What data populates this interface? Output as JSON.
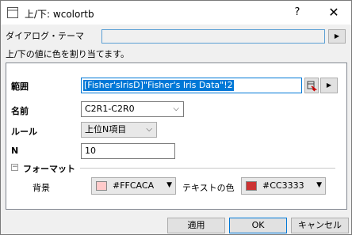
{
  "window": {
    "title": "上/下: wcolortb",
    "help_glyph": "?",
    "close_glyph": "✕"
  },
  "theme": {
    "label": "ダイアログ・テーマ",
    "value": ""
  },
  "description": "上/下の値に色を割り当てます。",
  "form": {
    "range_label": "範囲",
    "range_value": "[Fisher'sIrisD]\"Fisher's Iris Data\"!2",
    "name_label": "名前",
    "name_value": "C2R1-C2R0",
    "rule_label": "ルール",
    "rule_value": "上位N項目",
    "n_label": "N",
    "n_value": "10"
  },
  "format": {
    "section_label": "フォーマット",
    "collapse_glyph": "−",
    "bg_label": "背景",
    "bg_color_value": "#FFCACA",
    "bg_swatch": "#FFCACA",
    "text_color_label": "テキストの色",
    "text_color_value": "#CC3333",
    "text_swatch": "#CC3333"
  },
  "buttons": {
    "apply": "適用",
    "ok": "OK",
    "cancel": "キャンセル"
  },
  "glyphs": {
    "right_arrow": "▶",
    "chevron_down": "⌵",
    "down_triangle": "▼"
  }
}
